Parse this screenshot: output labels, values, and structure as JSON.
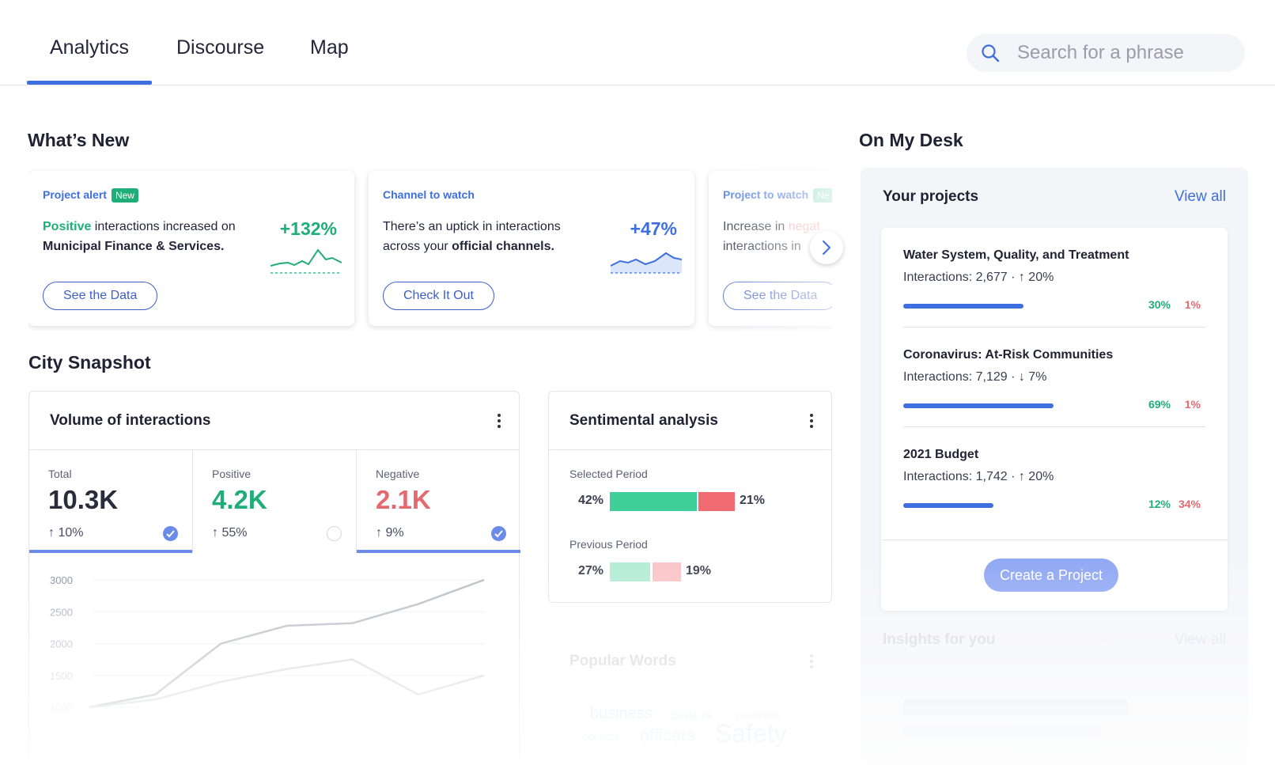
{
  "tabs": [
    {
      "label": "Analytics",
      "active": true
    },
    {
      "label": "Discourse",
      "active": false
    },
    {
      "label": "Map",
      "active": false
    }
  ],
  "search": {
    "placeholder": "Search for a phrase",
    "icon": "search-icon"
  },
  "whats_new": {
    "title": "What’s New",
    "cards": [
      {
        "kind": "Project alert",
        "badge": "New",
        "lead": "Positive",
        "text_mid": " interactions increased on ",
        "bold_tail": "Municipal Finance & Services.",
        "pct": "+132%",
        "pct_color": "#1fae77",
        "button": "See the Data"
      },
      {
        "kind": "Channel to watch",
        "text_mid": "There’s an uptick in interactions across your ",
        "bold_tail": "official channels.",
        "pct": "+47%",
        "pct_color": "#3d6fe0",
        "button": "Check It Out"
      },
      {
        "kind": "Project to watch",
        "badge": "Ne",
        "text_mid": "Increase in ",
        "lead": "negat",
        "text_tail": "interactions in",
        "button": "See the Data"
      }
    ]
  },
  "city_snapshot": {
    "title": "City Snapshot",
    "volume": {
      "title": "Volume of interactions",
      "metrics": [
        {
          "label": "Total",
          "value": "10.3K",
          "delta": "↑ 10%",
          "color": "#2a2c3c",
          "checked": true
        },
        {
          "label": "Positive",
          "value": "4.2K",
          "delta": "↑ 55%",
          "color": "#1fae77",
          "checked": false
        },
        {
          "label": "Negative",
          "value": "2.1K",
          "delta": "↑ 9%",
          "color": "#e46a70",
          "checked": true
        }
      ],
      "chart_data": {
        "type": "line",
        "y_ticks": [
          "3000",
          "2500",
          "2000",
          "1500",
          "1000"
        ],
        "ylim": [
          1000,
          3000
        ],
        "series": [
          {
            "values": [
              1000,
              1200,
              2000,
              2280,
              2320,
              2620,
              3000
            ]
          },
          {
            "values": [
              1000,
              1120,
              1400,
              1600,
              1750,
              1200,
              1500
            ]
          }
        ]
      }
    },
    "sentiment": {
      "title": "Sentimental analysis",
      "selected": {
        "label": "Selected Period",
        "positive": "42%",
        "negative": "21%",
        "positive_value": 42,
        "negative_value": 21
      },
      "previous": {
        "label": "Previous Period",
        "positive": "27%",
        "negative": "19%",
        "positive_value": 27,
        "negative_value": 19
      }
    },
    "popular": {
      "title": "Popular Words",
      "words": [
        "business",
        "Covid 19",
        "pandemic",
        "council",
        "officers",
        "Safety"
      ]
    }
  },
  "desk": {
    "title": "On My Desk",
    "projects_title": "Your projects",
    "view_all": "View all",
    "projects": [
      {
        "name": "Water System, Quality, and Treatment",
        "interactions": "Interactions: 2,677  ·  ↑  20%",
        "pos": "30%",
        "neg": "1%",
        "fill": 0.39
      },
      {
        "name": "Coronavirus: At-Risk Communities",
        "interactions": "Interactions: 7,129  ·  ↓  7%",
        "pos": "69%",
        "neg": "1%",
        "fill": 0.49
      },
      {
        "name": "2021 Budget",
        "interactions": "Interactions: 1,742  ·  ↑  20%",
        "pos": "12%",
        "neg": "34%",
        "fill": 0.29
      }
    ],
    "create_button": "Create a Project",
    "insights_title": "Insights for you",
    "insights_link": "View all"
  }
}
